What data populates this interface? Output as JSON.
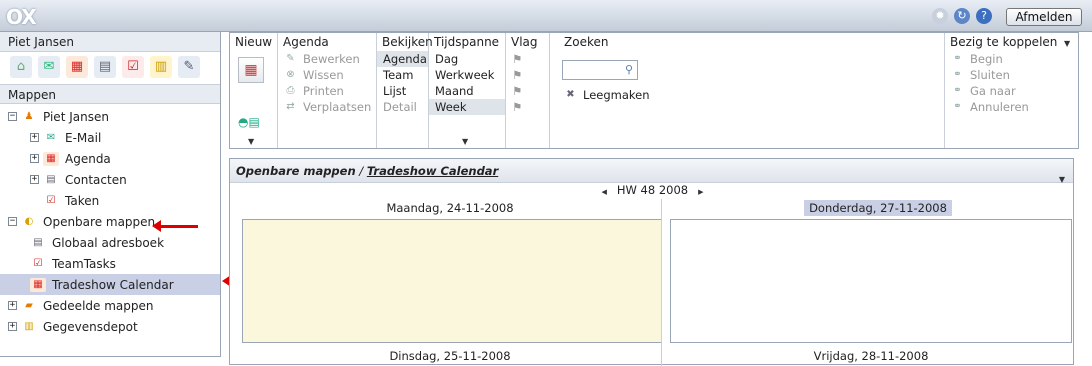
{
  "app": {
    "logo_text": "OX",
    "logout_label": "Afmelden",
    "icons": [
      "refresh-spinner-icon",
      "sync-icon",
      "help-icon"
    ]
  },
  "sidebar": {
    "user": "Piet Jansen",
    "module_icons": [
      "home-icon",
      "email-icon",
      "calendar-icon",
      "contacts-icon",
      "tasks-icon",
      "infostore-icon",
      "settings-icon"
    ],
    "section_label": "Mappen",
    "tree": [
      {
        "label": "Piet Jansen",
        "icon": "user-icon",
        "level": 0,
        "expander": "minus"
      },
      {
        "label": "E-Mail",
        "icon": "email-icon",
        "level": 1,
        "expander": "plus"
      },
      {
        "label": "Agenda",
        "icon": "calendar-icon",
        "level": 1,
        "expander": "plus"
      },
      {
        "label": "Contacten",
        "icon": "contacts-icon",
        "level": 1,
        "expander": "plus"
      },
      {
        "label": "Taken",
        "icon": "tasks-icon",
        "level": 1,
        "expander": ""
      },
      {
        "label": "Openbare mappen",
        "icon": "public-folder-icon",
        "level": 0,
        "expander": "minus"
      },
      {
        "label": "Globaal adresboek",
        "icon": "contacts-icon",
        "level": 1,
        "expander": ""
      },
      {
        "label": "TeamTasks",
        "icon": "tasks-icon",
        "level": 1,
        "expander": ""
      },
      {
        "label": "Tradeshow Calendar",
        "icon": "calendar-icon",
        "level": 1,
        "expander": "",
        "selected": true
      },
      {
        "label": "Gedeelde mappen",
        "icon": "shared-folder-icon",
        "level": 0,
        "expander": "plus"
      },
      {
        "label": "Gegevensdepot",
        "icon": "infostore-icon",
        "level": 0,
        "expander": "plus"
      }
    ]
  },
  "toolbar": {
    "groups": {
      "new": {
        "label": "Nieuw"
      },
      "agenda": {
        "label": "Agenda",
        "items": [
          "Bewerken",
          "Wissen",
          "Printen",
          "Verplaatsen"
        ]
      },
      "view": {
        "label": "Bekijken",
        "items": [
          "Agenda",
          "Team",
          "Lijst",
          "Detail"
        ]
      },
      "timespan": {
        "label": "Tijdspanne",
        "items": [
          "Dag",
          "Werkweek",
          "Maand",
          "Week"
        ]
      },
      "flag": {
        "label": "Vlag"
      },
      "search": {
        "label": "Zoeken",
        "clear_label": "Leegmaken",
        "value": ""
      },
      "link": {
        "label": "Bezig te koppelen",
        "items": [
          "Begin",
          "Sluiten",
          "Ga naar",
          "Annuleren"
        ]
      }
    }
  },
  "calendar": {
    "breadcrumb_root": "Openbare mappen",
    "breadcrumb_sep": " / ",
    "breadcrumb_current": "Tradeshow Calendar",
    "week_label": "HW 48 2008",
    "days": [
      {
        "label": "Maandag, 24-11-2008",
        "today": true
      },
      {
        "label": "Donderdag, 27-11-2008",
        "today": false
      },
      {
        "label": "Dinsdag, 25-11-2008",
        "today": false
      },
      {
        "label": "Vrijdag, 28-11-2008",
        "today": false
      }
    ]
  },
  "colors": {
    "annotation_arrow": "#dd0000",
    "today": "#fbf7dd",
    "selection": "#c9d0e6"
  }
}
